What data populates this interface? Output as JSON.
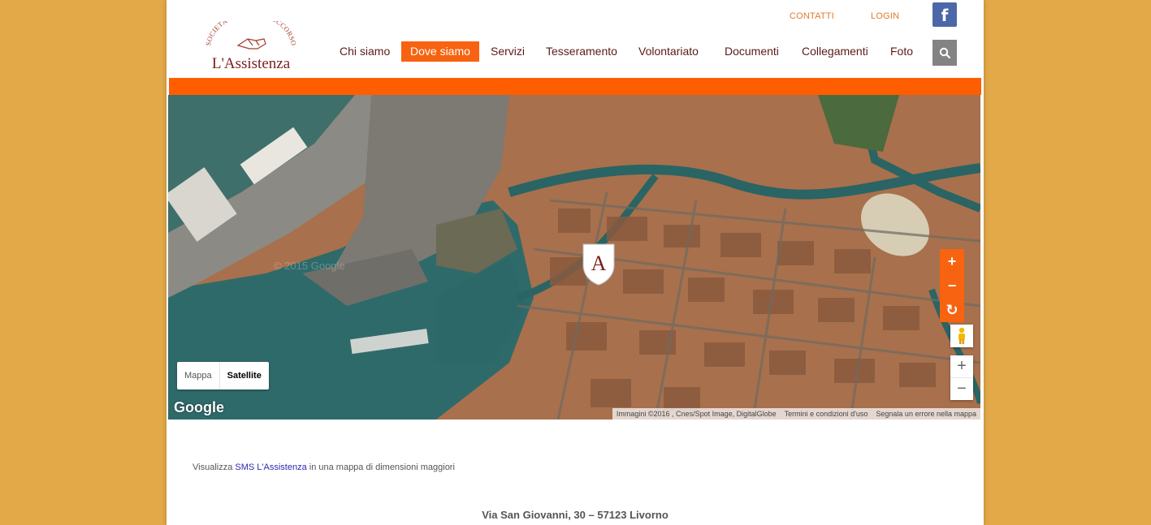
{
  "header": {
    "logo": {
      "arc_text": "SOCIETÀ DI MUTUO SOCCORSO",
      "name": "L'Assistenza"
    },
    "top_links": [
      "CONTATTI",
      "LOGIN"
    ],
    "facebook_glyph": "f",
    "nav": [
      {
        "label": "Chi siamo",
        "active": false
      },
      {
        "label": "Dove siamo",
        "active": true
      },
      {
        "label": "Servizi",
        "active": false
      },
      {
        "label": "Tesseramento",
        "active": false
      },
      {
        "label": "Volontariato",
        "active": false
      },
      {
        "label": "Documenti",
        "active": false
      },
      {
        "label": "Collegamenti",
        "active": false
      },
      {
        "label": "Foto",
        "active": false
      }
    ],
    "search_icon": "search-icon"
  },
  "colors": {
    "background": "#e3a948",
    "accent": "#f76310",
    "nav_text": "#5a1a18",
    "top_link": "#e27a2c",
    "facebook": "#4c68a8"
  },
  "map": {
    "type_buttons": [
      "Mappa",
      "Satellite"
    ],
    "selected_type": "Satellite",
    "google_logo": "Google",
    "attribution": [
      "Immagini ©2016 , Cnes/Spot Image, DigitalGlobe",
      "Termini e condizioni d'uso",
      "Segnala un errore nella mappa"
    ],
    "marker_letter": "A",
    "watermark": "© 2015 Google",
    "orange_controls": [
      "+",
      "−",
      "↻"
    ],
    "zoom_controls": [
      "+",
      "−"
    ]
  },
  "content": {
    "view_larger_prefix": "Visualizza ",
    "view_larger_link": "SMS L'Assistenza",
    "view_larger_suffix": " in una mappa di dimensioni maggiori",
    "address": "Via San Giovanni, 30 – 57123 Livorno"
  }
}
